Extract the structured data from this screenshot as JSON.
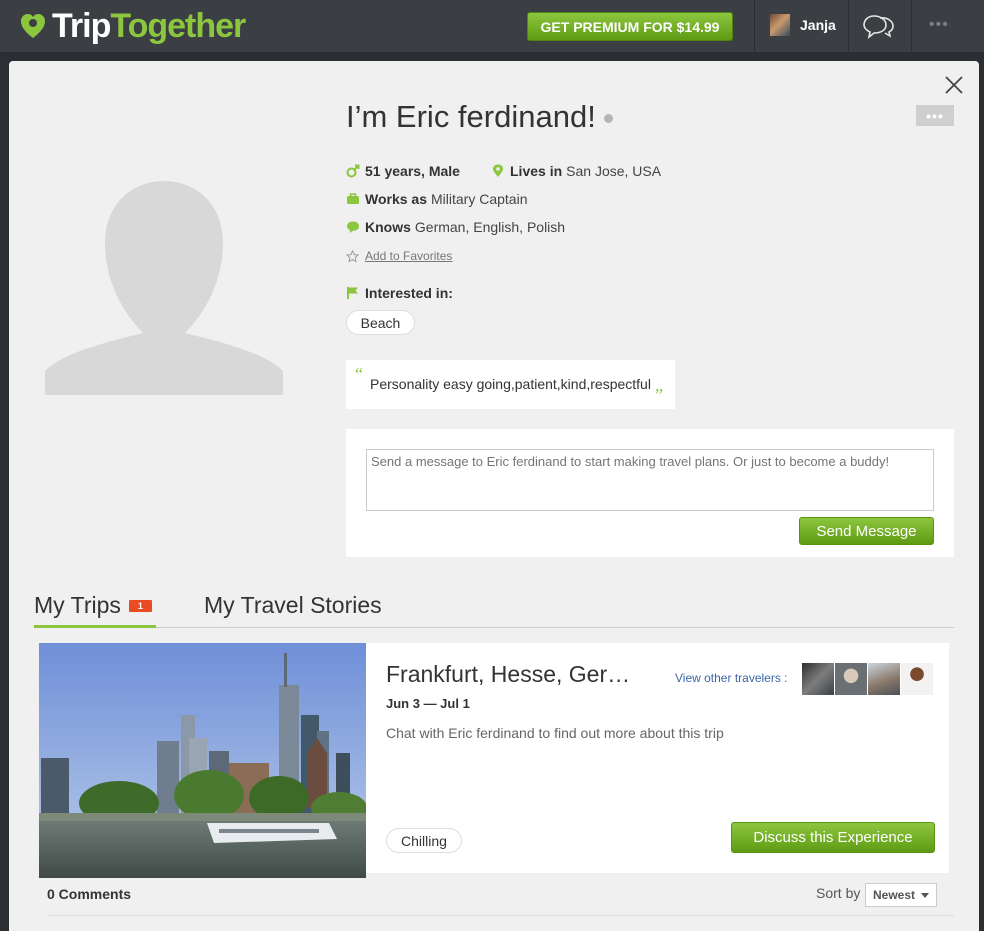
{
  "header": {
    "logo_trip": "Trip",
    "logo_together": "Together",
    "premium_label": "GET PREMIUM FOR $14.99",
    "user_name": "Janja",
    "more_label": "•••"
  },
  "profile": {
    "name": "I’m Eric ferdinand!",
    "age_gender": "51 years, Male",
    "lives_label": "Lives in",
    "lives_value": "San Jose, USA",
    "works_label": "Works as",
    "works_value": "Military Captain",
    "knows_label": "Knows",
    "knows_value": "German, English, Polish",
    "favorites_label": "Add to Favorites",
    "interested_label": "Interested in:",
    "interests": [
      "Beach"
    ],
    "quote": "Personality easy going,patient,kind,respectful",
    "more_label": "•••"
  },
  "message": {
    "placeholder": "Send a message to Eric ferdinand to start making travel plans. Or just to become a buddy!",
    "send_label": "Send Message"
  },
  "tabs": [
    {
      "label": "My Trips",
      "badge": "1"
    },
    {
      "label": "My Travel Stories"
    }
  ],
  "trip": {
    "title": "Frankfurt, Hesse, Ger…",
    "dates": "Jun 3 — Jul 1",
    "description": "Chat with Eric ferdinand to find out more about this trip",
    "view_travelers": "View other travelers :",
    "tag": "Chilling",
    "discuss_label": "Discuss this Experience"
  },
  "comments": {
    "count_label": "0 Comments",
    "sort_label": "Sort by",
    "sort_value": "Newest"
  },
  "colors": {
    "accent": "#8cc63e",
    "topbar": "#3b3f43",
    "badge": "#e94b25"
  }
}
